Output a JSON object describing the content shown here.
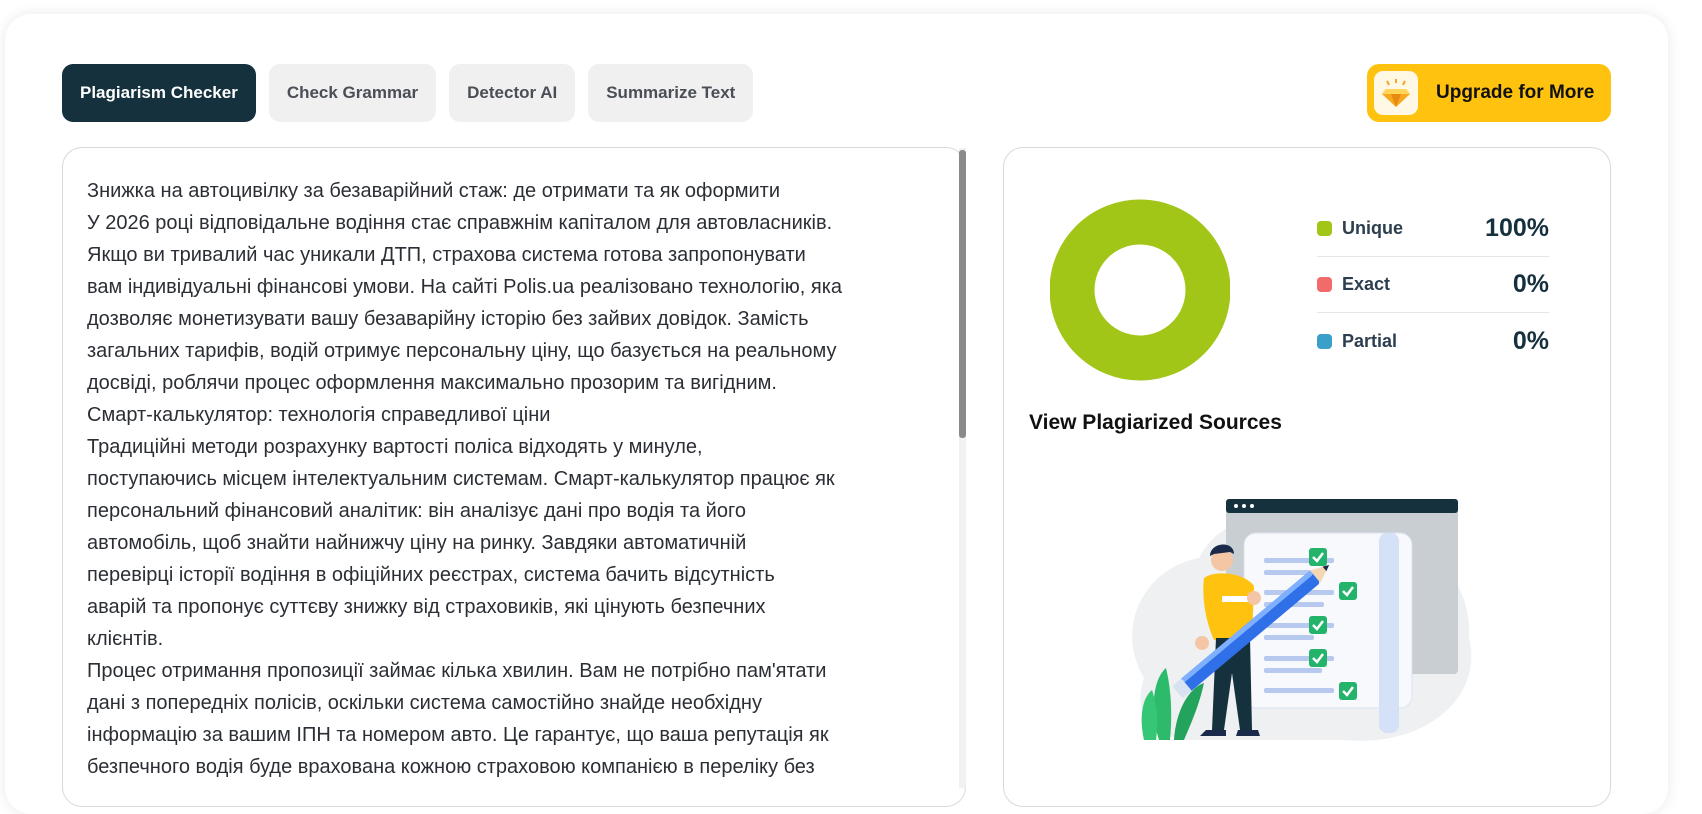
{
  "tabs": [
    {
      "label": "Plagiarism Checker",
      "active": true
    },
    {
      "label": "Check Grammar",
      "active": false
    },
    {
      "label": "Detector AI",
      "active": false
    },
    {
      "label": "Summarize Text",
      "active": false
    }
  ],
  "upgrade": {
    "label": "Upgrade for More",
    "icon": "diamond-icon"
  },
  "editor": {
    "text": "Знижка на автоцивілку за безаварійний стаж: де отримати та як оформити\nУ 2026 році відповідальне водіння стає справжнім капіталом для автовласників.\nЯкщо ви тривалий час уникали ДТП, страхова система готова запропонувати\nвам індивідуальні фінансові умови. На сайті Polis.ua реалізовано технологію, яка\nдозволяє монетизувати вашу безаварійну історію без зайвих довідок. Замість\nзагальних тарифів, водій отримує персональну ціну, що базується на реальному\nдосвіді, роблячи процес оформлення максимально прозорим та вигідним.\nСмарт-калькулятор: технологія справедливої ціни\nТрадиційні методи розрахунку вартості поліса відходять у минуле,\nпоступаючись місцем інтелектуальним системам. Смарт-калькулятор працює як\nперсональний фінансовий аналітик: він аналізує дані про водія та його\nавтомобіль, щоб знайти найнижчу ціну на ринку. Завдяки автоматичній\nперевірці історії водіння в офіційних реєстрах, система бачить відсутність\nаварій та пропонує суттєву знижку від страховиків, які цінують безпечних\nклієнтів.\nПроцес отримання пропозиції займає кілька хвилин. Вам не потрібно пам'ятати\nдані з попередніх полісів, оскільки система самостійно знайде необхідну\nінформацію за вашим ІПН та номером авто. Це гарантує, що ваша репутація як\nбезпечного водія буде врахована кожною страховою компанією в переліку без"
  },
  "results": {
    "legend": [
      {
        "name": "Unique",
        "value": "100%",
        "color": "#a2c617"
      },
      {
        "name": "Exact",
        "value": "0%",
        "color": "#f26b6b"
      },
      {
        "name": "Partial",
        "value": "0%",
        "color": "#3a9fc9"
      }
    ],
    "unique_fraction": 1.0,
    "sources_title": "View Plagiarized Sources"
  },
  "colors": {
    "accent_dark": "#15313d",
    "upgrade": "#ffc20e",
    "unique": "#a2c617"
  }
}
